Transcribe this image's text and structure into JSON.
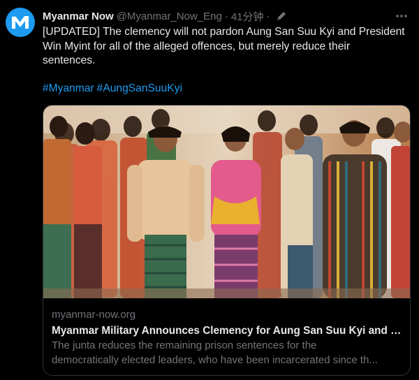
{
  "tweet": {
    "author_name": "Myanmar Now",
    "author_handle": "@Myanmar_Now_Eng",
    "separator": "·",
    "time": "41分钟",
    "text": "[UPDATED] The clemency will not pardon Aung San Suu Kyi and President\nWin Myint for all of the alleged offences, but merely reduce their\nsentences.",
    "hashtags": [
      "#Myanmar",
      "#AungSanSuuKyi"
    ]
  },
  "card": {
    "domain": "myanmar-now.org",
    "title": "Myanmar Military Announces Clemency for Aung San Suu Kyi and Pre...",
    "description_line1": "The junta reduces the remaining prison sentences for the",
    "description_line2": "democratically elected leaders, who have been incarcerated since th..."
  },
  "icons": {
    "avatar": "myanmar-now-logo-icon",
    "edit": "edit-pencil-icon",
    "more": "more-dots-icon"
  },
  "colors": {
    "background": "#000000",
    "text": "#e7e9ea",
    "muted": "#71767b",
    "link": "#1d9bf0",
    "border": "#2f3336"
  }
}
